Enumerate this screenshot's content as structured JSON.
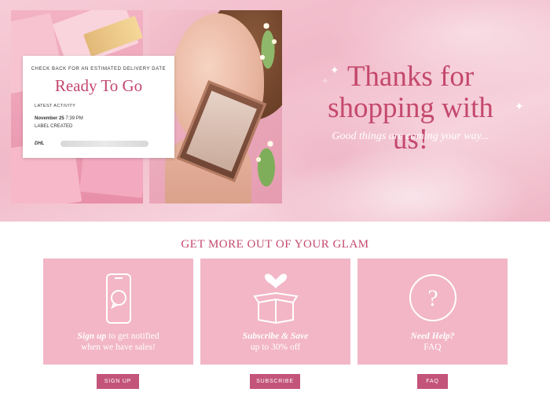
{
  "tracking_card": {
    "check_back": "CHECK BACK FOR AN ESTIMATED DELIVERY DATE",
    "status": "Ready To Go",
    "latest_activity_label": "LATEST ACTIVITY",
    "activity_date": "November 25",
    "activity_time": "7:39 PM",
    "activity_status": "LABEL CREATED",
    "carrier": "DHL"
  },
  "hero": {
    "headline_line1": "Thanks for",
    "headline_line2": "shopping with us!",
    "tagline": "Good things are coming your way..."
  },
  "section": {
    "title": "GET MORE OUT OF YOUR GLAM"
  },
  "tiles": [
    {
      "icon": "phone-chat-icon",
      "emphasis": "Sign up",
      "line1_rest": " to get notified",
      "line2": "when we have sales!",
      "button": "SIGN UP"
    },
    {
      "icon": "gift-box-heart-icon",
      "emphasis": "Subscribe & Save",
      "line1_rest": "",
      "line2": "up to 30% off",
      "button": "SUBSCRIBE"
    },
    {
      "icon": "question-circle-icon",
      "emphasis": "Need Help?",
      "line1_rest": "",
      "line2": "FAQ",
      "button": "FAQ"
    }
  ],
  "colors": {
    "brand_pink": "#c4486e",
    "tile_pink": "#f2b6c7",
    "button_pink": "#c3547a"
  }
}
